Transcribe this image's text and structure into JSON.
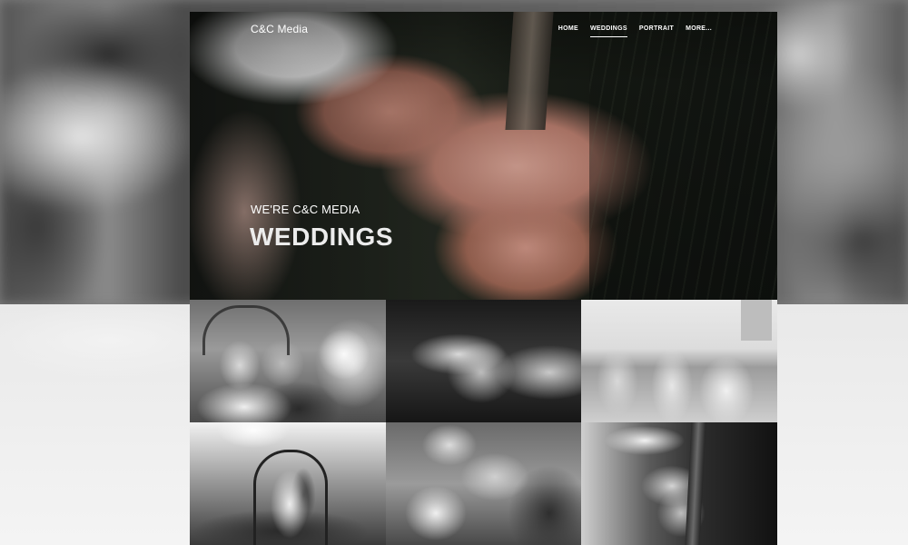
{
  "site": {
    "brand": "C&C Media"
  },
  "nav": {
    "items": [
      {
        "label": "HOME",
        "active": false
      },
      {
        "label": "WEDDINGS",
        "active": true
      },
      {
        "label": "PORTRAIT",
        "active": false
      },
      {
        "label": "MORE..."
      }
    ]
  },
  "hero": {
    "subtitle": "WE'RE C&C MEDIA",
    "title": "WEDDINGS",
    "image": "couple-hands-rings-photo"
  },
  "gallery": {
    "tiles": [
      {
        "name": "groom-crying-under-arch-photo"
      },
      {
        "name": "couple-hands-embrace-photo"
      },
      {
        "name": "beach-ceremony-photo"
      },
      {
        "name": "tent-ceremony-arch-photo"
      },
      {
        "name": "ring-exchange-photo"
      },
      {
        "name": "hands-on-wooden-post-photo"
      }
    ]
  },
  "colors": {
    "nav_text": "#ffffff",
    "hero_title": "#ececec"
  }
}
